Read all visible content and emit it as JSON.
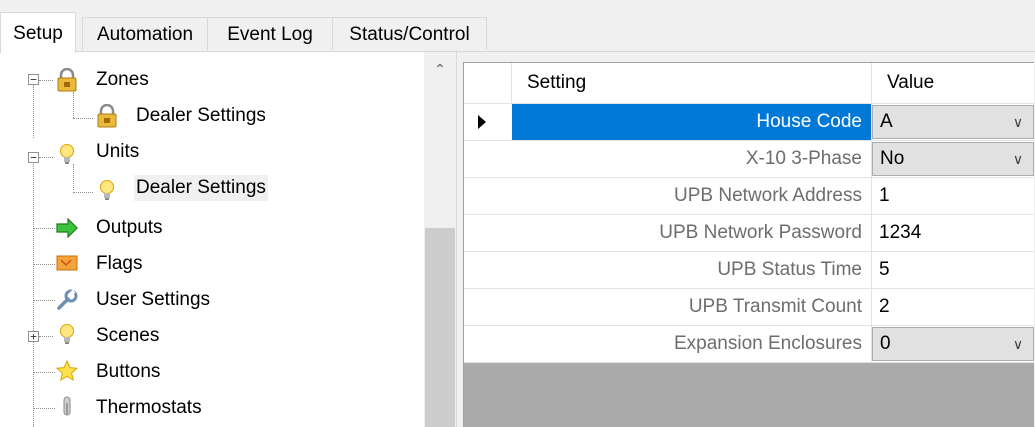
{
  "tabs": [
    {
      "label": "Setup",
      "active": true
    },
    {
      "label": "Automation",
      "active": false
    },
    {
      "label": "Event Log",
      "active": false
    },
    {
      "label": "Status/Control",
      "active": false
    }
  ],
  "tree": {
    "items": [
      {
        "label": "Zones",
        "icon": "lock-icon",
        "expander": "−"
      },
      {
        "label": "Dealer Settings",
        "icon": "lock-icon"
      },
      {
        "label": "Units",
        "icon": "lightbulb-icon",
        "expander": "−"
      },
      {
        "label": "Dealer Settings",
        "icon": "lightbulb-icon",
        "selected": true
      },
      {
        "label": "Outputs",
        "icon": "arrow-right-icon"
      },
      {
        "label": "Flags",
        "icon": "flag-icon"
      },
      {
        "label": "User Settings",
        "icon": "wrench-icon"
      },
      {
        "label": "Scenes",
        "icon": "lightbulb-icon",
        "expander": "+"
      },
      {
        "label": "Buttons",
        "icon": "star-icon"
      },
      {
        "label": "Thermostats",
        "icon": "thermometer-icon"
      }
    ]
  },
  "scrollbar": {
    "up_arrow": "⌃"
  },
  "grid": {
    "headers": {
      "setting": "Setting",
      "value": "Value"
    },
    "rows": [
      {
        "setting": "House Code",
        "value": "A",
        "combo": true,
        "selected": true
      },
      {
        "setting": "X-10 3-Phase",
        "value": "No",
        "combo": true
      },
      {
        "setting": "UPB Network Address",
        "value": "1"
      },
      {
        "setting": "UPB Network Password",
        "value": "1234"
      },
      {
        "setting": "UPB Status Time",
        "value": "5"
      },
      {
        "setting": "UPB Transmit Count",
        "value": "2"
      },
      {
        "setting": "Expansion Enclosures",
        "value": "0",
        "combo": true
      }
    ],
    "combo_arrow": "∨"
  }
}
